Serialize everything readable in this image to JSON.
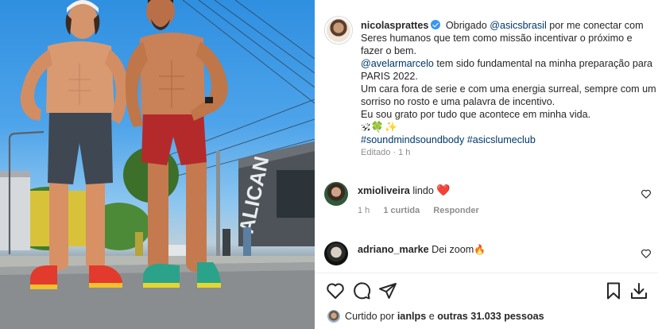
{
  "post": {
    "author": "nicolasprattes",
    "caption": {
      "p1_pre": "Obrigado ",
      "p1_mention": "@asicsbrasil",
      "p1_post": " por me conectar com Seres humanos que tem como missão incentivar o próximo e fazer o bem.",
      "p2_mention": "@avelarmarcelo",
      "p2_post": " tem sido fundamental na minha preparação para PARIS 2022.",
      "p3": "Um cara fora de serie e com uma energia surreal, sempre com um sorriso no rosto e uma palavra de incentivo.",
      "p4": "Eu sou grato por tudo que acontece em minha vida.",
      "emojis": "🕉🍀✨",
      "hashtags": "#soundmindsoundbody #asicslumeclub"
    },
    "edited_label": "Editado · 1 h"
  },
  "comments": [
    {
      "username": "xmioliveira",
      "text": "lindo",
      "emoji": "❤️",
      "time": "1 h",
      "likes": "1 curtida",
      "reply": "Responder"
    },
    {
      "username": "adriano_marke",
      "text": "Dei zoom",
      "emoji": "🔥"
    }
  ],
  "likes": {
    "prefix": "Curtido por ",
    "user": "ianlps",
    "middle": " e ",
    "others": "outras 31.033 pessoas"
  },
  "photo": {
    "sign_text": "ALICAN"
  }
}
